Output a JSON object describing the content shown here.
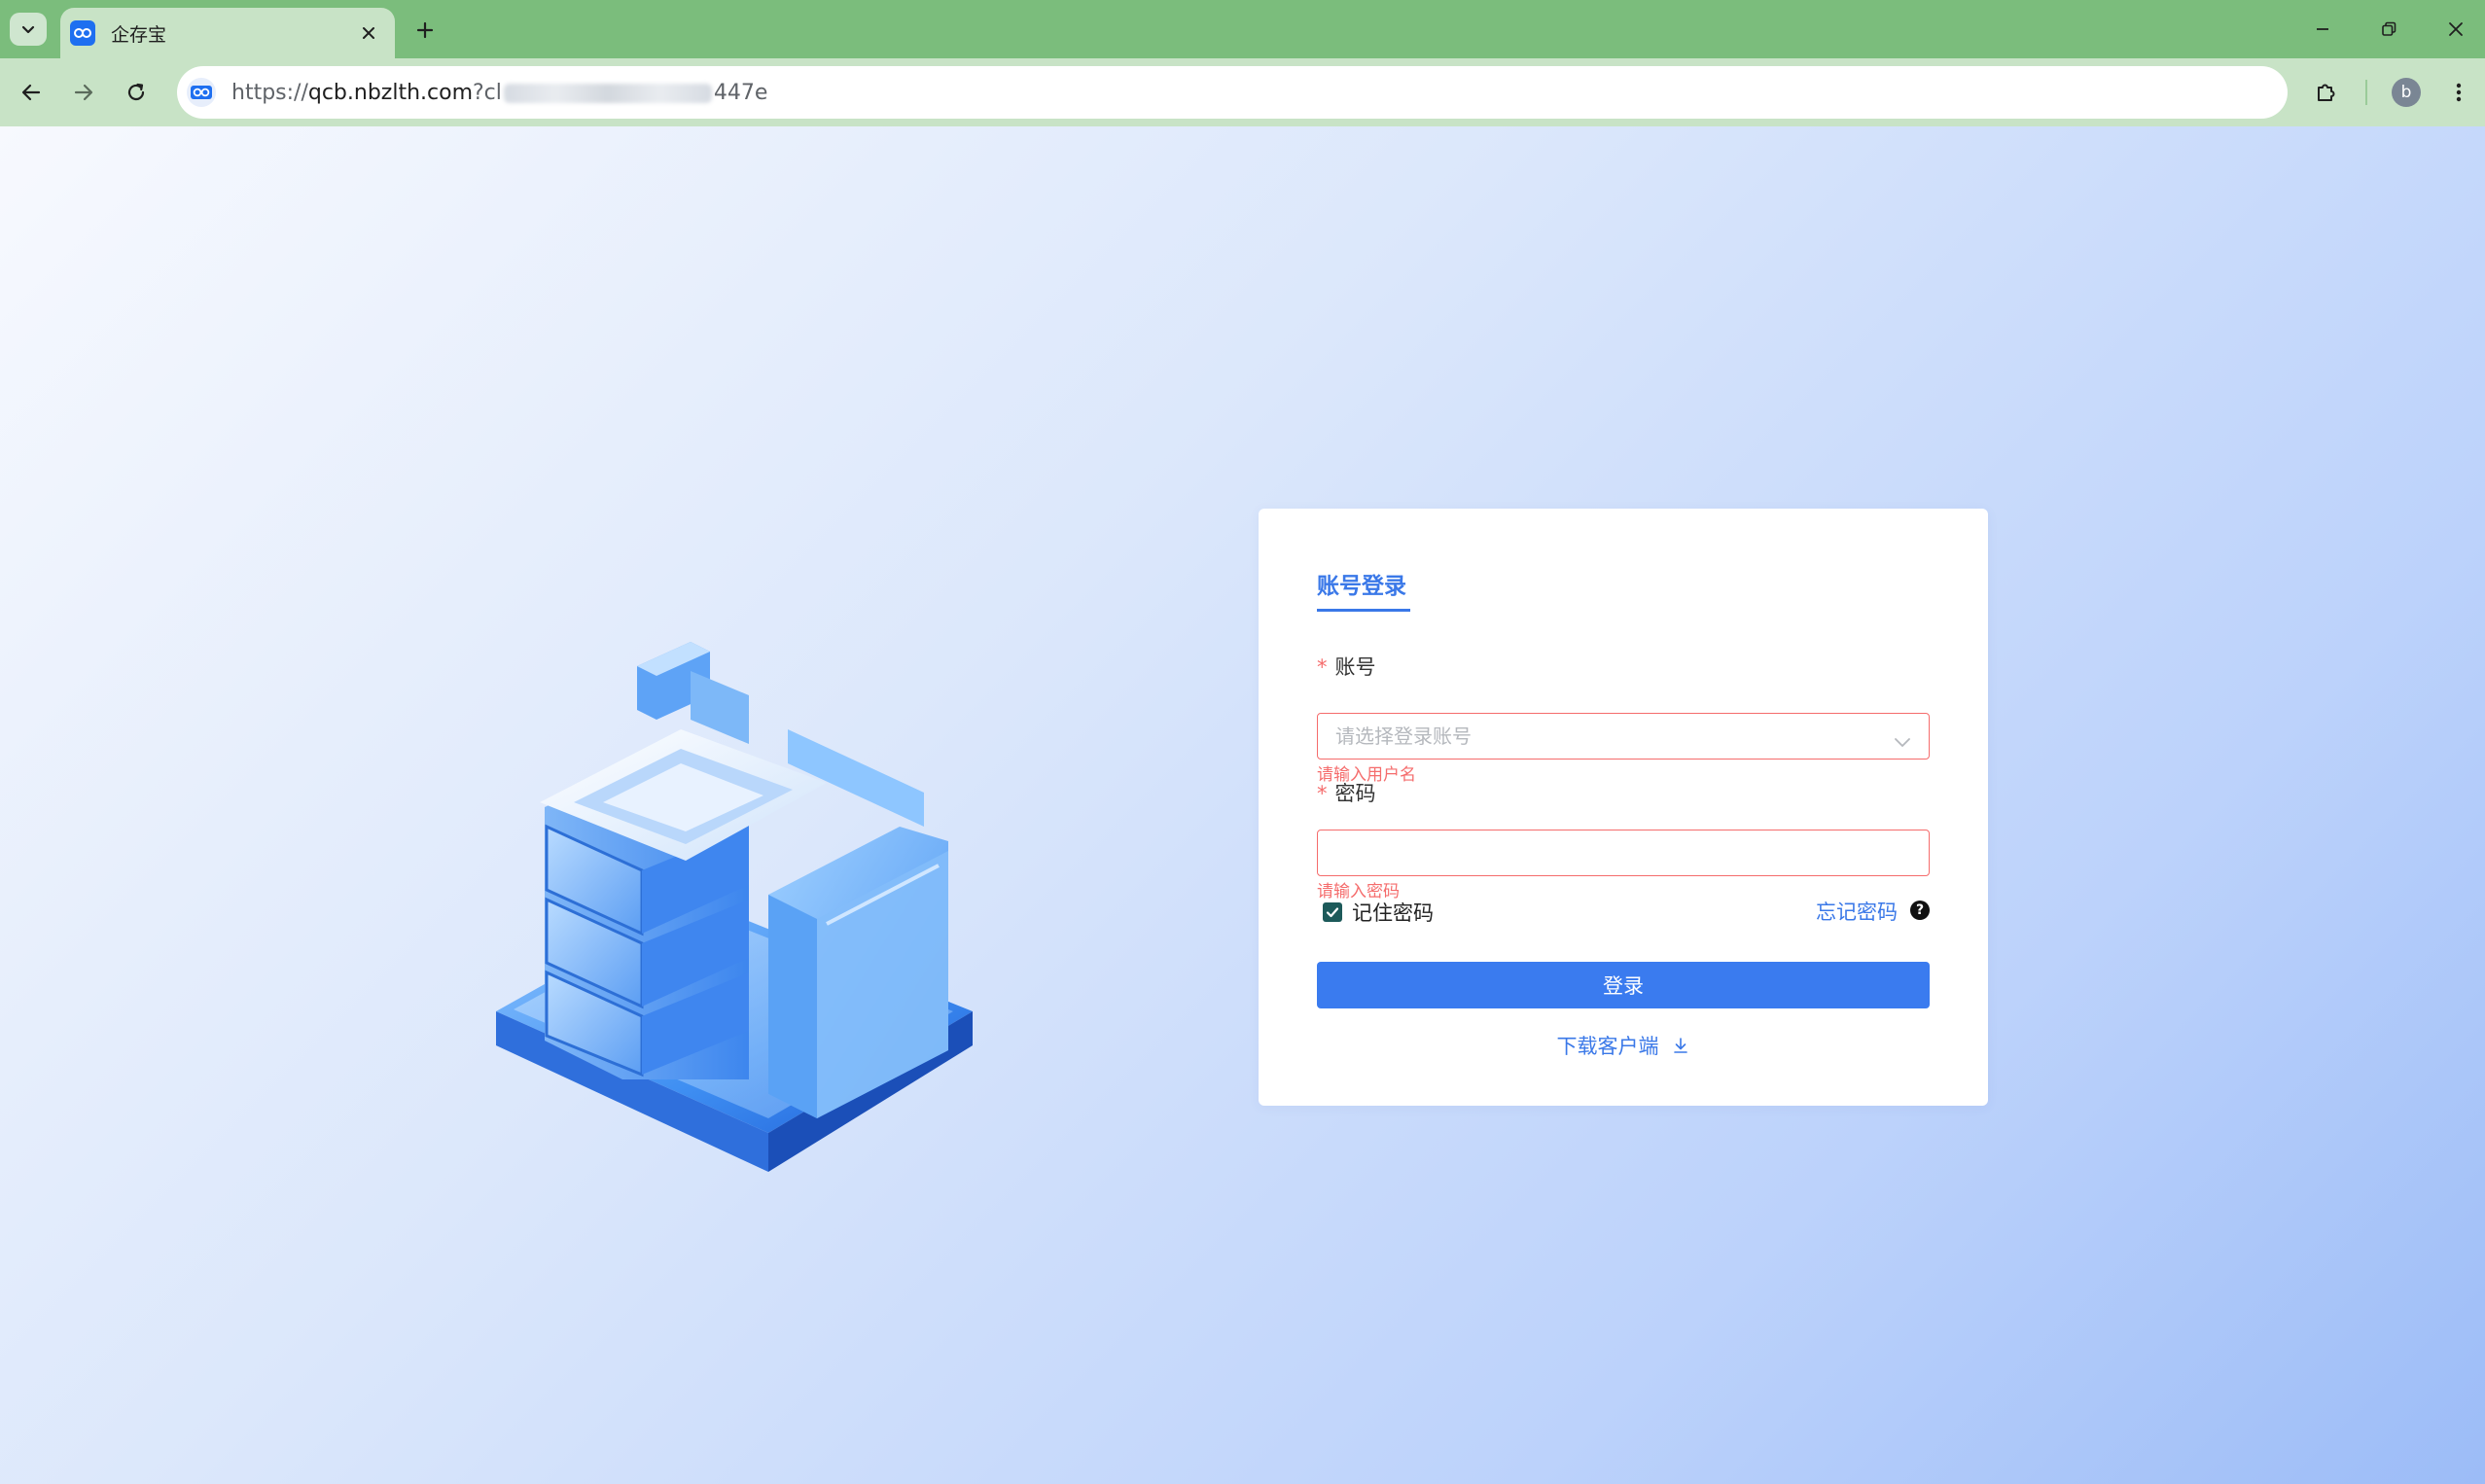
{
  "browser": {
    "tab_title": "企存宝",
    "url_prefix": "https://",
    "url_host": "qcb.nbzlth.com",
    "url_query_start": "?cl",
    "url_query_end": "447e",
    "profile_initial": "b"
  },
  "login": {
    "tab_label": "账号登录",
    "required_mark": "*",
    "account_label": "账号",
    "account_placeholder": "请选择登录账号",
    "account_error": "请输入用户名",
    "password_label": "密码",
    "password_value": "",
    "password_error": "请输入密码",
    "remember_label": "记住密码",
    "remember_checked": true,
    "forgot_label": "忘记密码",
    "help_glyph": "?",
    "submit_label": "登录",
    "download_label": "下载客户端"
  },
  "colors": {
    "accent": "#3a78e8",
    "error": "#f56c6c",
    "chrome_green": "#7bbd7c"
  }
}
